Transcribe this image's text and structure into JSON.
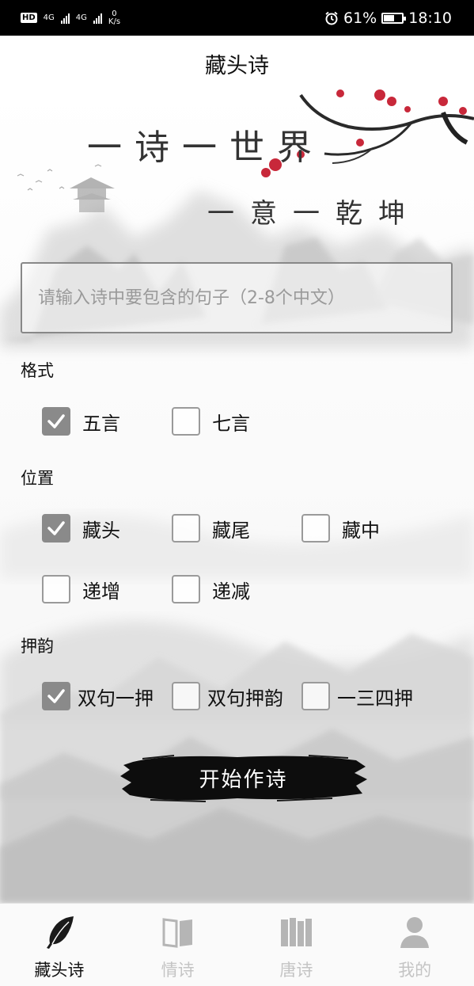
{
  "status_bar": {
    "hd_badge": "HD",
    "net1": "4G",
    "net2": "4G",
    "speed_value": "0",
    "speed_unit": "K/s",
    "alarm_icon": "alarm-icon",
    "battery_text": "61%",
    "battery_level": 0.61,
    "time": "18:10"
  },
  "header": {
    "title": "藏头诗"
  },
  "hero": {
    "line1": "一诗一世界",
    "line2": "一意一乾坤"
  },
  "input": {
    "placeholder": "请输入诗中要包含的句子（2-8个中文）",
    "value": ""
  },
  "format": {
    "label": "格式",
    "options": [
      {
        "label": "五言",
        "checked": true
      },
      {
        "label": "七言",
        "checked": false
      }
    ]
  },
  "position": {
    "label": "位置",
    "options": [
      {
        "label": "藏头",
        "checked": true
      },
      {
        "label": "藏尾",
        "checked": false
      },
      {
        "label": "藏中",
        "checked": false
      },
      {
        "label": "递增",
        "checked": false
      },
      {
        "label": "递减",
        "checked": false
      }
    ]
  },
  "rhyme": {
    "label": "押韵",
    "options": [
      {
        "label": "双句一押",
        "checked": true
      },
      {
        "label": "双句押韵",
        "checked": false
      },
      {
        "label": "一三四押",
        "checked": false
      }
    ]
  },
  "start_button": {
    "label": "开始作诗"
  },
  "nav": {
    "items": [
      {
        "label": "藏头诗",
        "icon": "feather-quill-icon",
        "active": true
      },
      {
        "label": "情诗",
        "icon": "open-book-icon",
        "active": false
      },
      {
        "label": "唐诗",
        "icon": "books-icon",
        "active": false
      },
      {
        "label": "我的",
        "icon": "user-icon",
        "active": false
      }
    ]
  },
  "colors": {
    "checked_box": "#8a8a8a",
    "nav_active": "#111111",
    "nav_inactive": "#c4c4c4",
    "plum_blossom": "#c8283a"
  }
}
